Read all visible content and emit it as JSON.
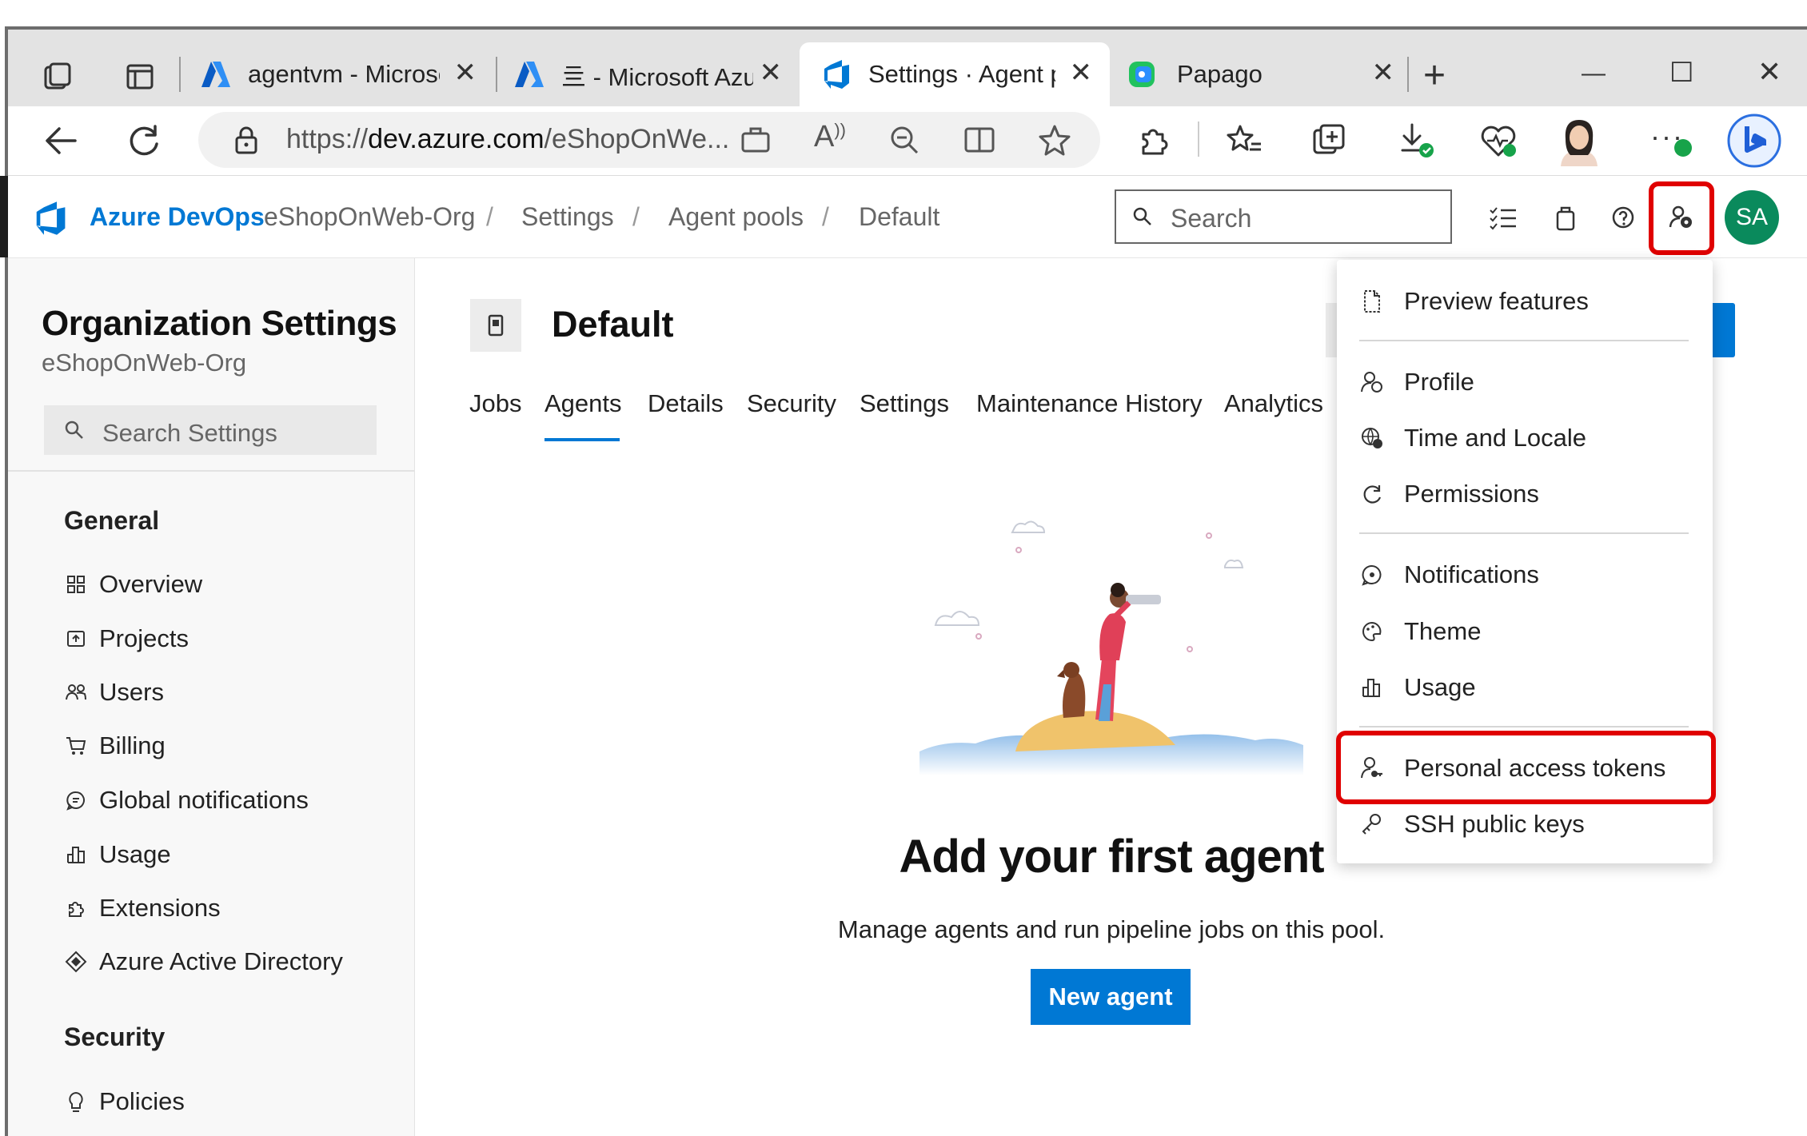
{
  "browser": {
    "tabs": [
      {
        "label": "agentvm - Microsc"
      },
      {
        "label": "亖 - Microsoft Azu"
      },
      {
        "label": "Settings · Agent pc",
        "active": true
      },
      {
        "label": "Papago"
      }
    ],
    "url_prefix": "https://",
    "url_host": "dev.azure.com",
    "url_path": "/eShopOnWe...",
    "window_controls": {
      "minimize": "—",
      "maximize": "☐",
      "close": "✕"
    }
  },
  "header": {
    "brand": "Azure DevOps",
    "breadcrumb": [
      "eShopOnWeb-Org",
      "Settings",
      "Agent pools",
      "Default"
    ],
    "search_placeholder": "Search",
    "avatar_initials": "SA"
  },
  "sidebar": {
    "title": "Organization Settings",
    "subtitle": "eShopOnWeb-Org",
    "search_placeholder": "Search Settings",
    "sections": [
      {
        "heading": "General",
        "items": [
          "Overview",
          "Projects",
          "Users",
          "Billing",
          "Global notifications",
          "Usage",
          "Extensions",
          "Azure Active Directory"
        ]
      },
      {
        "heading": "Security",
        "items": [
          "Policies"
        ]
      }
    ]
  },
  "main": {
    "title": "Default",
    "tabs": [
      "Jobs",
      "Agents",
      "Details",
      "Security",
      "Settings",
      "Maintenance History",
      "Analytics"
    ],
    "active_tab": "Agents",
    "empty_title": "Add your first agent",
    "empty_desc": "Manage agents and run pipeline jobs on this pool.",
    "new_agent_label": "New agent"
  },
  "user_menu": {
    "items": [
      "Preview features",
      "Profile",
      "Time and Locale",
      "Permissions",
      "Notifications",
      "Theme",
      "Usage",
      "Personal access tokens",
      "SSH public keys"
    ],
    "highlighted": "Personal access tokens"
  },
  "colors": {
    "accent": "#0078d4",
    "highlight": "#e00000",
    "avatar": "#0a8a5c"
  }
}
